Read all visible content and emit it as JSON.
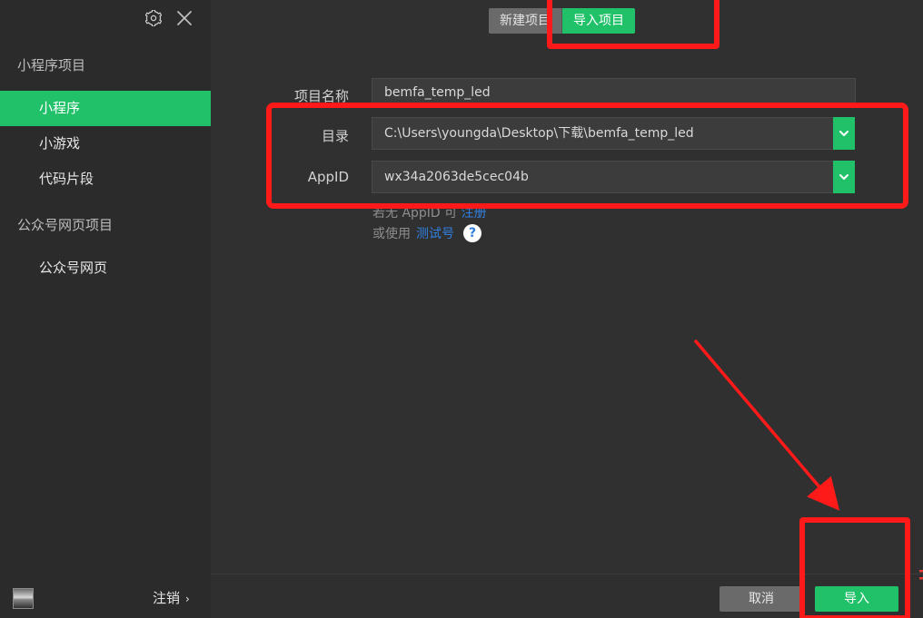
{
  "sidebar": {
    "section_mini_program": "小程序项目",
    "items": [
      {
        "label": "小程序"
      },
      {
        "label": "小游戏"
      },
      {
        "label": "代码片段"
      }
    ],
    "section_official_account": "公众号网页项目",
    "official_items": [
      {
        "label": "公众号网页"
      }
    ],
    "footer": {
      "logout_label": "注销",
      "logout_chevron": "›"
    }
  },
  "header": {
    "tabs": [
      {
        "label": "新建项目"
      },
      {
        "label": "导入项目"
      }
    ]
  },
  "form": {
    "project_name_label": "项目名称",
    "project_name_value": "bemfa_temp_led",
    "directory_label": "目录",
    "directory_value": "C:\\Users\\youngda\\Desktop\\下载\\bemfa_temp_led",
    "appid_label": "AppID",
    "appid_value": "wx34a2063de5cec04b",
    "hint_no_appid_prefix": "若无 AppID 可",
    "hint_no_appid_link": "注册",
    "hint_or_use_prefix": "或使用",
    "hint_or_use_link": "测试号",
    "help_icon": "?"
  },
  "actions": {
    "cancel_label": "取消",
    "import_label": "导入"
  },
  "colors": {
    "accent": "#21c16a",
    "background": "#303030",
    "sidebar": "#2b2b2b",
    "annotation": "#ff1a1a",
    "link": "#2f7fe0"
  },
  "icons": {
    "settings": "gear-icon",
    "close": "close-icon",
    "dropdown": "chevron-down-icon",
    "help": "question-circle-icon"
  }
}
